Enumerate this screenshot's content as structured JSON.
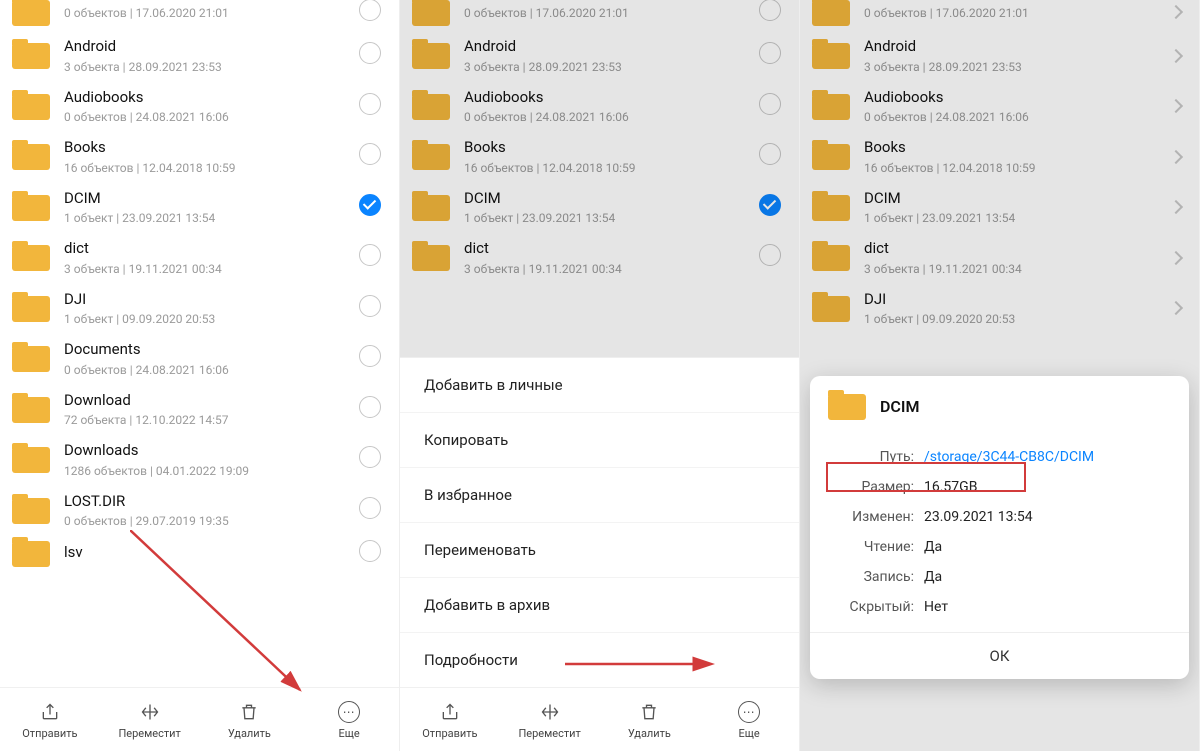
{
  "items": [
    {
      "name": "",
      "detail": "0 объектов  |  17.06.2020 21:01",
      "selected": false,
      "cut": true
    },
    {
      "name": "Android",
      "detail": "3 объекта  |  28.09.2021 23:53",
      "selected": false
    },
    {
      "name": "Audiobooks",
      "detail": "0 объектов  |  24.08.2021 16:06",
      "selected": false
    },
    {
      "name": "Books",
      "detail": "16 объектов  |  12.04.2018 10:59",
      "selected": false
    },
    {
      "name": "DCIM",
      "detail": "1 объект  |  23.09.2021 13:54",
      "selected": true
    },
    {
      "name": "dict",
      "detail": "3 объекта  |  19.11.2021 00:34",
      "selected": false
    },
    {
      "name": "DJI",
      "detail": "1 объект  |  09.09.2020 20:53",
      "selected": false
    },
    {
      "name": "Documents",
      "detail": "0 объектов  |  24.08.2021 16:06",
      "selected": false
    },
    {
      "name": "Download",
      "detail": "72 объекта  |  12.10.2022 14:57",
      "selected": false
    },
    {
      "name": "Downloads",
      "detail": "1286 объектов  |  04.01.2022 19:09",
      "selected": false
    },
    {
      "name": "LOST.DIR",
      "detail": "0 объектов  |  29.07.2019 19:35",
      "selected": false
    },
    {
      "name": "lsv",
      "detail": "",
      "selected": false,
      "cut": true
    }
  ],
  "panel2_visible_count": 6,
  "panel3_visible_count": 7,
  "bottombar": {
    "send": {
      "label": "Отправить",
      "glyph": "share"
    },
    "move": {
      "label": "Переместит",
      "glyph": "move"
    },
    "delete": {
      "label": "Удалить",
      "glyph": "trash"
    },
    "more": {
      "label": "Еще",
      "glyph": "more"
    }
  },
  "sheet": [
    "Добавить в личные",
    "Копировать",
    "В избранное",
    "Переименовать",
    "Добавить в архив",
    "Подробности"
  ],
  "dialog": {
    "title": "DCIM",
    "rows": {
      "path": {
        "k": "Путь:",
        "v": "/storage/3C44-CB8C/DCIM",
        "link": true
      },
      "size": {
        "k": "Размер:",
        "v": "16.57GB"
      },
      "modified": {
        "k": "Изменен:",
        "v": "23.09.2021 13:54"
      },
      "read": {
        "k": "Чтение:",
        "v": "Да"
      },
      "write": {
        "k": "Запись:",
        "v": "Да"
      },
      "hidden": {
        "k": "Скрытый:",
        "v": "Нет"
      }
    },
    "ok": "ОК"
  }
}
